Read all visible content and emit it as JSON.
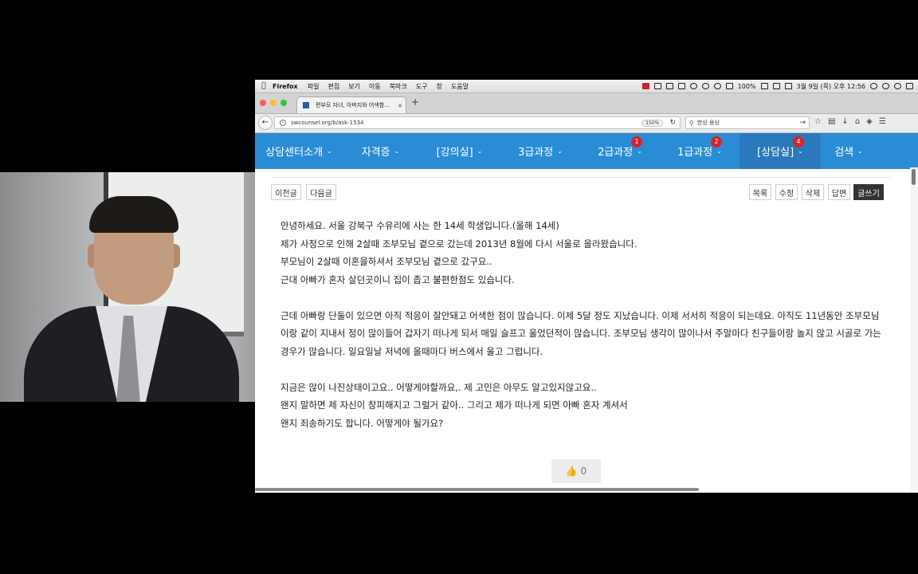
{
  "menubar": {
    "apple": "",
    "app": "Firefox",
    "items": [
      "파일",
      "편집",
      "보기",
      "이동",
      "북마크",
      "도구",
      "창",
      "도움말"
    ],
    "battery": "100%",
    "clock": "3월 9일 (목) 오후 12:56"
  },
  "tab": {
    "title": "편부모 자녀, 아버지와 어색함...",
    "close": "×",
    "newtab": "+"
  },
  "address": {
    "url": "swcounsel.org/b/ask-1534",
    "zoom": "150%",
    "search_query": "한상 용상"
  },
  "nav": {
    "items": [
      {
        "label": "상담센터소개",
        "badge": ""
      },
      {
        "label": "자격증",
        "badge": ""
      },
      {
        "label": "[강의실]",
        "badge": ""
      },
      {
        "label": "3급과정",
        "badge": ""
      },
      {
        "label": "2급과정",
        "badge": "1"
      },
      {
        "label": "1급과정",
        "badge": "2"
      },
      {
        "label": "[상담실]",
        "badge": "4"
      },
      {
        "label": "검색",
        "badge": ""
      }
    ],
    "caret": "⌄",
    "accent": "#2a8cd5",
    "active_bg": "#2b79bd",
    "badge_color": "#d8232a"
  },
  "post": {
    "prev_label": "이전글",
    "next_label": "다음글",
    "list_label": "목록",
    "edit_label": "수정",
    "delete_label": "삭제",
    "reply_label": "답변",
    "write_label": "글쓰기",
    "lines": [
      "안녕하세요. 서울 강북구 수유리에 사는 한 14세 학생입니다.(올해 14세)",
      "제가 사정으로 인해 2살때 조부모님 곁으로 갔는데 2013년 8월에 다시 서울로 올라왔습니다.",
      "부모님이 2살때 이혼을하셔서 조부모님 곁으로 갔구요..",
      "근대 아빠가 혼자 살던곳이니 집이 좁고 불편한점도 있습니다.",
      "근데 아빠랑 단둘이 있으면 아직 적응이 잘안돼고 어색한 점이 많습니다. 이제 5달 정도 지났습니다. 이제 서서히 적응이 되는데요. 아직도 11년동안 조부모님이랑 같이 지내서 정이 많이들어 갑자기 떠나게 되서 매일 슬프고 울었던적이 많습니다. 조부모님 생각이 많이나서 주말마다 친구들이랑 놀지 않고 시골로 가는경우가 많습니다. 일요일날 저녁에 올때마다 버스에서 울고 그럽니다.",
      "지금은 많이 나진상태이고요.. 어떻게야할까요,. 제 고민은 아무도 알고있지않고요..",
      "왠지 말하면 제 자신이 창피해지고 그럴거 같아.. 그리고 제가 떠나게 되면 아빠 혼자 계셔서",
      "왠지 죄송하기도 합니다. 어떻게야 될가요?"
    ],
    "like_count": "0"
  }
}
